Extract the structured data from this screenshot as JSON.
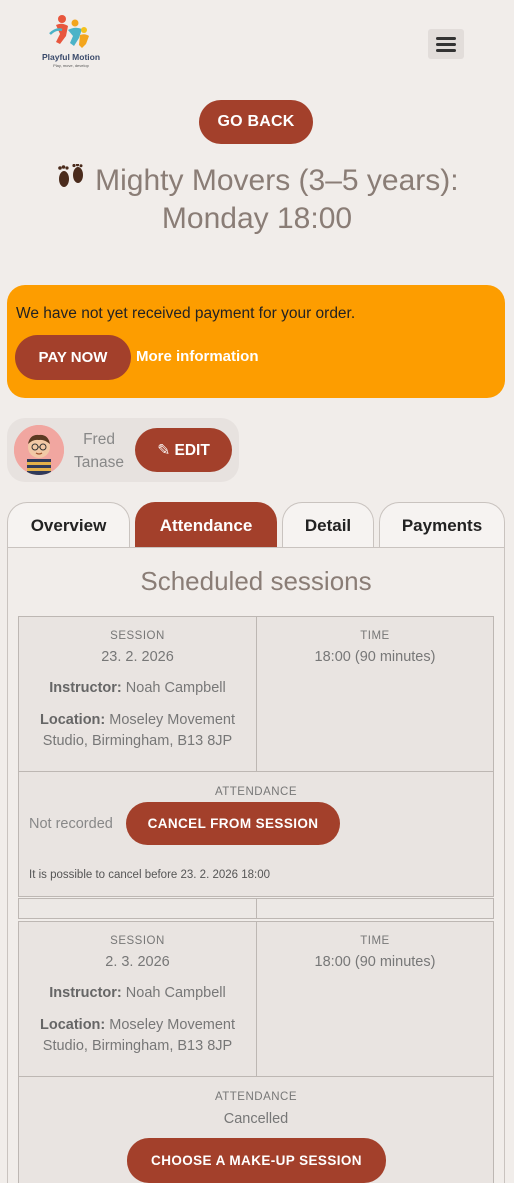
{
  "header": {
    "logo_name": "Playful Motion",
    "logo_tagline": "Play, move, develop",
    "menu_icon": "hamburger-menu-icon"
  },
  "nav": {
    "go_back_label": "GO BACK"
  },
  "page": {
    "title_icon": "footprints-icon",
    "title_line1": "Mighty Movers (3–5 years):",
    "title_line2": "Monday 18:00"
  },
  "payment_alert": {
    "message": "We have not yet received payment for your order.",
    "pay_now_label": "PAY NOW",
    "more_info_label": "More information",
    "color": "#fd9d00"
  },
  "child": {
    "first_name": "Fred",
    "last_name": "Tanase",
    "edit_label": "✎ EDIT",
    "avatar_icon": "child-avatar-icon"
  },
  "tabs": [
    {
      "label": "Overview",
      "active": false
    },
    {
      "label": "Attendance",
      "active": true
    },
    {
      "label": "Detail",
      "active": false
    },
    {
      "label": "Payments",
      "active": false
    }
  ],
  "section": {
    "title": "Scheduled sessions"
  },
  "labels": {
    "session": "SESSION",
    "time": "TIME",
    "attendance": "ATTENDANCE",
    "instructor": "Instructor:",
    "location": "Location:"
  },
  "sessions": [
    {
      "date": "23. 2. 2026",
      "time": "18:00 (90 minutes)",
      "instructor": "Noah Campbell",
      "location": "Moseley Movement Studio, Birmingham, B13 8JP",
      "attendance_status": "Not recorded",
      "action_label": "CANCEL FROM SESSION",
      "note": "It is possible to cancel before 23. 2. 2026 18:00"
    },
    {
      "date": "2. 3. 2026",
      "time": "18:00 (90 minutes)",
      "instructor": "Noah Campbell",
      "location": "Moseley Movement Studio, Birmingham, B13 8JP",
      "attendance_status": "Cancelled",
      "action_label": "CHOOSE A MAKE-UP SESSION"
    }
  ],
  "colors": {
    "accent": "#a3402b",
    "background": "#f1edea",
    "title": "#8a7d76"
  }
}
